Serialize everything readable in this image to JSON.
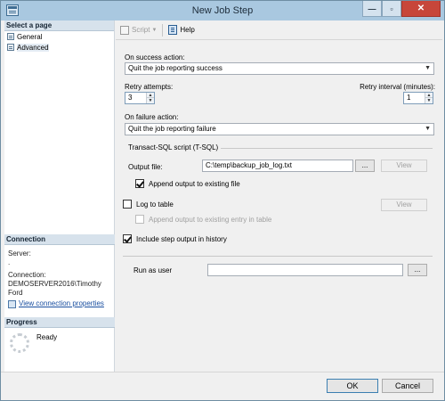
{
  "window": {
    "title": "New Job Step"
  },
  "titlebar_buttons": {
    "minimize": "—",
    "maximize": "▫",
    "close": "✕"
  },
  "left_panel": {
    "select_page_header": "Select a page",
    "pages": [
      {
        "label": "General"
      },
      {
        "label": "Advanced",
        "selected": true
      }
    ],
    "connection": {
      "header": "Connection",
      "server_label": "Server:",
      "server_value": ".",
      "connection_label": "Connection:",
      "connection_value": "DEMOSERVER2016\\Timothy Ford",
      "view_properties_link": "View connection properties"
    },
    "progress": {
      "header": "Progress",
      "status": "Ready"
    }
  },
  "toolbar": {
    "script_label": "Script",
    "help_label": "Help"
  },
  "form": {
    "on_success_label": "On success action:",
    "on_success_value": "Quit the job reporting success",
    "retry_attempts_label": "Retry attempts:",
    "retry_attempts_value": "3",
    "retry_interval_label": "Retry interval (minutes):",
    "retry_interval_value": "1",
    "on_failure_label": "On failure action:",
    "on_failure_value": "Quit the job reporting failure",
    "tsql_section_label": "Transact-SQL script (T-SQL)",
    "output_file_label": "Output file:",
    "output_file_value": "C:\\temp\\backup_job_log.txt",
    "browse_label": "...",
    "view_label": "View",
    "append_output_label": "Append output to existing file",
    "append_output_checked": true,
    "log_to_table_label": "Log to table",
    "log_to_table_checked": false,
    "log_view_label": "View",
    "append_table_label": "Append output to existing entry in table",
    "append_table_checked": false,
    "include_history_label": "Include step output in history",
    "include_history_checked": true,
    "run_as_user_label": "Run as user",
    "run_as_user_value": "",
    "run_as_browse_label": "..."
  },
  "dialog_buttons": {
    "ok": "OK",
    "cancel": "Cancel"
  },
  "colors": {
    "titlebar": "#a9c8e0",
    "close_button": "#c7463a",
    "link": "#1a4fa0",
    "panel_header": "#d7e2ec"
  },
  "icons": {
    "app": "job-step-window-icon",
    "page": "page-icon",
    "script": "script-icon",
    "help": "help-icon",
    "connection": "connection-properties-icon",
    "progress": "progress-spinner-icon"
  }
}
